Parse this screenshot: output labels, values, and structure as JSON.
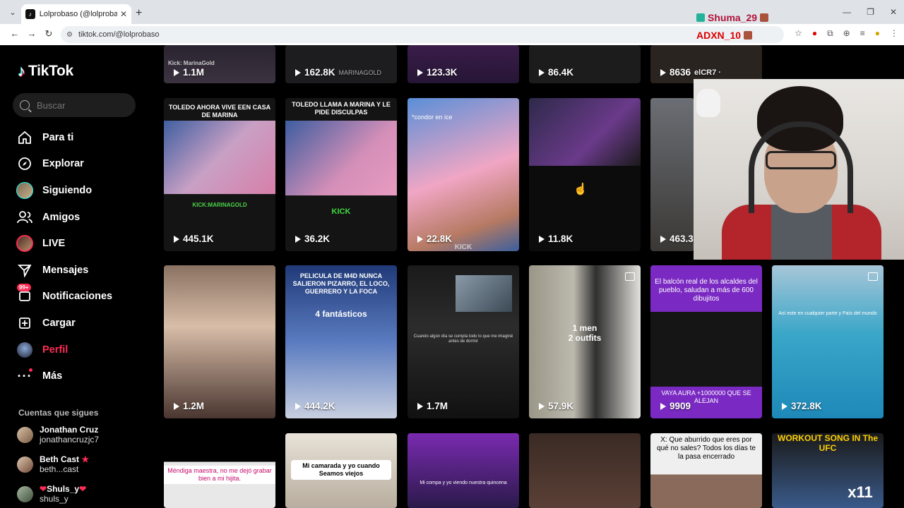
{
  "browser": {
    "tab_title": "Lolprobaso (@lolprobaso) | TikTok",
    "url": "tiktok.com/@lolprobaso",
    "new_tab": "+",
    "close": "✕"
  },
  "overlay": {
    "user1": "Shuma_29",
    "user2": "ADXN_10"
  },
  "sidebar": {
    "logo": "TikTok",
    "search_placeholder": "Buscar",
    "nav": [
      {
        "label": "Para ti",
        "icon": "home-icon"
      },
      {
        "label": "Explorar",
        "icon": "compass-icon"
      },
      {
        "label": "Siguiendo",
        "icon": "avatar-icon"
      },
      {
        "label": "Amigos",
        "icon": "friends-icon"
      },
      {
        "label": "LIVE",
        "icon": "live-avatar-icon"
      },
      {
        "label": "Mensajes",
        "icon": "send-icon"
      },
      {
        "label": "Notificaciones",
        "icon": "inbox-icon",
        "badge": "99+"
      },
      {
        "label": "Cargar",
        "icon": "upload-icon"
      },
      {
        "label": "Perfil",
        "icon": "profile-avatar-icon",
        "active": true
      },
      {
        "label": "Más",
        "icon": "more-icon"
      }
    ],
    "following_title": "Cuentas que sigues",
    "accounts": [
      {
        "name": "Jonathan Cruz",
        "handle": "jonathancruzjc7"
      },
      {
        "name": "Beth Cast",
        "handle": "beth...cast"
      },
      {
        "name": "Shuls_y",
        "handle": "shuls_y"
      }
    ]
  },
  "videos": {
    "row0": [
      "1.1M",
      "162.8K",
      "123.3K",
      "86.4K",
      "8636"
    ],
    "row0_caption_1": "Kick: MarinaGold",
    "row0_caption_2": "MARINAGOLD",
    "row0_caption_5": "elCR7 ·",
    "row1": [
      "445.1K",
      "36.2K",
      "22.8K",
      "11.8K",
      "463.3"
    ],
    "row1_caption_1": "TOLEDO AHORA VIVE EEN CASA DE MARINA",
    "row1_caption_1b": "KICK:MARINAGOLD",
    "row1_caption_2": "TOLEDO LLAMA A MARINA Y LE PIDE DISCULPAS",
    "row1_caption_2b": "KICK",
    "row1_caption_3": "*condor en ice",
    "row1_caption_3b": "KICK",
    "row2": [
      "1.2M",
      "444.2K",
      "1.7M",
      "57.9K",
      "9909",
      "372.8K"
    ],
    "row2_caption_2": "PELICULA DE M4D NUNCA SALIERON PIZARRO, EL LOCO, GUERRERO Y LA FOCA",
    "row2_caption_2b": "4 fantásticos",
    "row2_caption_3": "Cuando algún día se cumpla todo lo que me imaginé antes de dormir",
    "row2_caption_4": "1 men\n2 outfits",
    "row2_caption_5": "El balcón real de los alcaldes del pueblo, saludan a más de 600 dibujitos",
    "row2_caption_5b": "VAYA AURA +1000000 QUE SE ALEJAN",
    "row2_caption_6": "Así este en cualquier parte y País del mundo",
    "row3_caption_1": "Méndiga maestra, no me dejó grabar bien a mi hijita.",
    "row3_caption_2": "Mi camarada y yo cuando Seamos viejos",
    "row3_caption_3": "Mi compa y yo viendo nuestra quincena",
    "row3_caption_5": "X: Que aburrido que eres por qué no sales? Todos los días te la pasa encerrado",
    "row3_caption_6": "WORKOUT SONG IN The UFC",
    "row3_caption_6b": "x11"
  },
  "colors": {
    "accent": "#fe2c55",
    "bg": "#000000",
    "chrome": "#dfe3e8"
  }
}
